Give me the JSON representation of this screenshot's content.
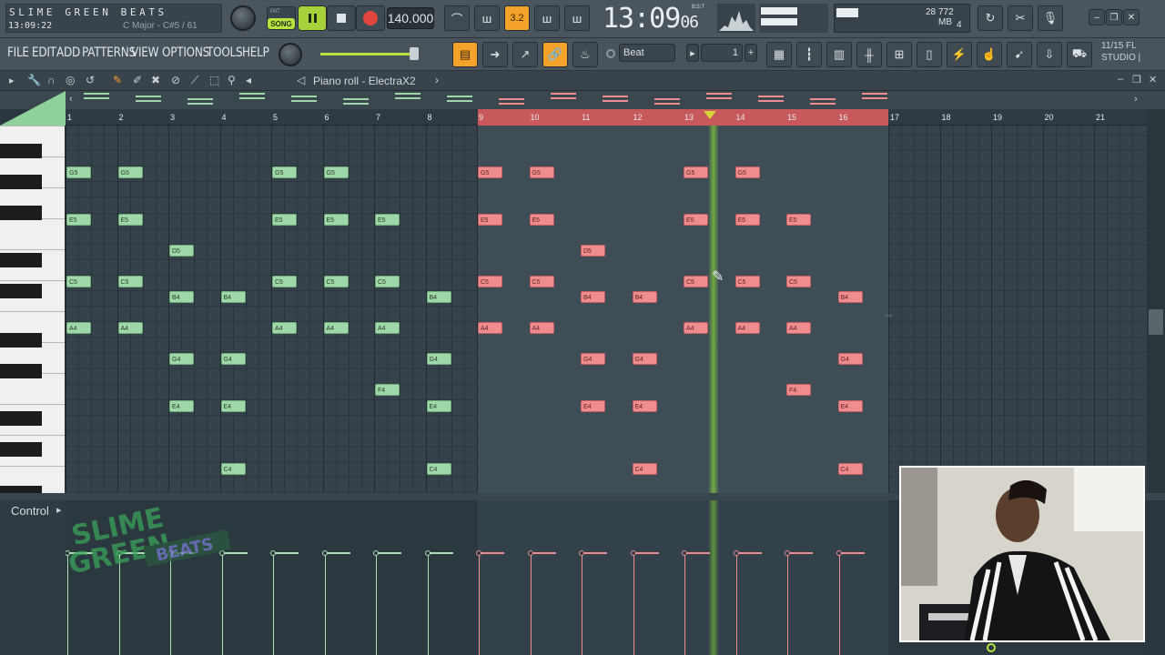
{
  "brand": {
    "title": "SLIME GREEN BEATS",
    "time": "13:09:22",
    "hint": "C Major - C#5 / 61"
  },
  "transport": {
    "mode_pat": "PAT",
    "mode_song": "SONG",
    "tempo": "140.000",
    "clock": "13:09",
    "clock_sub": "06",
    "bst": "B:S:T",
    "snap_value": "3.2"
  },
  "cpu": {
    "value1": "28",
    "mem": "772 MB",
    "value2": "4"
  },
  "menu": {
    "items": [
      "FILE",
      "EDIT",
      "ADD",
      "PATTERNS",
      "VIEW",
      "OPTIONS",
      "TOOLS",
      "HELP"
    ]
  },
  "toolbar": {
    "snap": "Beat",
    "pattern_num": "1",
    "version_line1": "11/15  FL",
    "version_line2": "STUDIO |"
  },
  "pianoroll": {
    "title": "Piano roll - ElectraX2"
  },
  "ruler": {
    "bars": [
      "1",
      "2",
      "3",
      "4",
      "5",
      "6",
      "7",
      "8",
      "9",
      "10",
      "11",
      "12",
      "13",
      "14",
      "15",
      "16",
      "17",
      "18",
      "19",
      "20",
      "21"
    ]
  },
  "control": {
    "label": "Control"
  },
  "watermark": {
    "line1": "SLIME",
    "line2": "GREEN",
    "line3": "BEATS"
  },
  "colors": {
    "song_green": "#b7e33e",
    "note_green": "#9fd8a8",
    "note_red": "#ef8c8e",
    "selection_ruler": "#c7585b",
    "accent_orange": "#f4a22a"
  },
  "notes": [
    {
      "label": "G5",
      "bar": 1,
      "color": "g"
    },
    {
      "label": "G5",
      "bar": 2,
      "color": "g"
    },
    {
      "label": "G5",
      "bar": 5,
      "color": "g"
    },
    {
      "label": "G5",
      "bar": 6,
      "color": "g"
    },
    {
      "label": "G5",
      "bar": 9,
      "color": "r"
    },
    {
      "label": "G5",
      "bar": 10,
      "color": "r"
    },
    {
      "label": "G5",
      "bar": 13,
      "color": "r"
    },
    {
      "label": "G5",
      "bar": 14,
      "color": "r"
    },
    {
      "label": "E5",
      "bar": 1,
      "color": "g"
    },
    {
      "label": "E5",
      "bar": 2,
      "color": "g"
    },
    {
      "label": "E5",
      "bar": 5,
      "color": "g"
    },
    {
      "label": "E5",
      "bar": 6,
      "color": "g"
    },
    {
      "label": "E5",
      "bar": 7,
      "color": "g"
    },
    {
      "label": "E5",
      "bar": 9,
      "color": "r"
    },
    {
      "label": "E5",
      "bar": 10,
      "color": "r"
    },
    {
      "label": "E5",
      "bar": 13,
      "color": "r"
    },
    {
      "label": "E5",
      "bar": 14,
      "color": "r"
    },
    {
      "label": "E5",
      "bar": 15,
      "color": "r"
    },
    {
      "label": "D5",
      "bar": 3,
      "color": "g"
    },
    {
      "label": "D5",
      "bar": 11,
      "color": "r"
    },
    {
      "label": "C5",
      "bar": 1,
      "color": "g"
    },
    {
      "label": "C5",
      "bar": 2,
      "color": "g"
    },
    {
      "label": "C5",
      "bar": 5,
      "color": "g"
    },
    {
      "label": "C5",
      "bar": 6,
      "color": "g"
    },
    {
      "label": "C5",
      "bar": 7,
      "color": "g"
    },
    {
      "label": "C5",
      "bar": 9,
      "color": "r"
    },
    {
      "label": "C5",
      "bar": 10,
      "color": "r"
    },
    {
      "label": "C5",
      "bar": 13,
      "color": "r"
    },
    {
      "label": "C5",
      "bar": 14,
      "color": "r"
    },
    {
      "label": "C5",
      "bar": 15,
      "color": "r"
    },
    {
      "label": "B4",
      "bar": 3,
      "color": "g"
    },
    {
      "label": "B4",
      "bar": 4,
      "color": "g"
    },
    {
      "label": "B4",
      "bar": 8,
      "color": "g"
    },
    {
      "label": "B4",
      "bar": 11,
      "color": "r"
    },
    {
      "label": "B4",
      "bar": 12,
      "color": "r"
    },
    {
      "label": "B4",
      "bar": 16,
      "color": "r"
    },
    {
      "label": "A4",
      "bar": 1,
      "color": "g"
    },
    {
      "label": "A4",
      "bar": 2,
      "color": "g"
    },
    {
      "label": "A4",
      "bar": 5,
      "color": "g"
    },
    {
      "label": "A4",
      "bar": 6,
      "color": "g"
    },
    {
      "label": "A4",
      "bar": 7,
      "color": "g"
    },
    {
      "label": "A4",
      "bar": 9,
      "color": "r"
    },
    {
      "label": "A4",
      "bar": 10,
      "color": "r"
    },
    {
      "label": "A4",
      "bar": 13,
      "color": "r"
    },
    {
      "label": "A4",
      "bar": 14,
      "color": "r"
    },
    {
      "label": "A4",
      "bar": 15,
      "color": "r"
    },
    {
      "label": "G4",
      "bar": 3,
      "color": "g"
    },
    {
      "label": "G4",
      "bar": 4,
      "color": "g"
    },
    {
      "label": "G4",
      "bar": 8,
      "color": "g"
    },
    {
      "label": "G4",
      "bar": 11,
      "color": "r"
    },
    {
      "label": "G4",
      "bar": 12,
      "color": "r"
    },
    {
      "label": "G4",
      "bar": 16,
      "color": "r"
    },
    {
      "label": "F4",
      "bar": 7,
      "color": "g"
    },
    {
      "label": "F4",
      "bar": 15,
      "color": "r"
    },
    {
      "label": "E4",
      "bar": 3,
      "color": "g"
    },
    {
      "label": "E4",
      "bar": 4,
      "color": "g"
    },
    {
      "label": "E4",
      "bar": 8,
      "color": "g"
    },
    {
      "label": "E4",
      "bar": 11,
      "color": "r"
    },
    {
      "label": "E4",
      "bar": 12,
      "color": "r"
    },
    {
      "label": "E4",
      "bar": 16,
      "color": "r"
    },
    {
      "label": "C4",
      "bar": 4,
      "color": "g"
    },
    {
      "label": "C4",
      "bar": 8,
      "color": "g"
    },
    {
      "label": "C4",
      "bar": 12,
      "color": "r"
    },
    {
      "label": "C4",
      "bar": 16,
      "color": "r"
    }
  ],
  "velocities": [
    {
      "bar": 1,
      "color": "g"
    },
    {
      "bar": 2,
      "color": "g"
    },
    {
      "bar": 3,
      "color": "g"
    },
    {
      "bar": 4,
      "color": "g"
    },
    {
      "bar": 5,
      "color": "g"
    },
    {
      "bar": 6,
      "color": "g"
    },
    {
      "bar": 7,
      "color": "g"
    },
    {
      "bar": 8,
      "color": "g"
    },
    {
      "bar": 9,
      "color": "r"
    },
    {
      "bar": 10,
      "color": "r"
    },
    {
      "bar": 11,
      "color": "r"
    },
    {
      "bar": 12,
      "color": "r"
    },
    {
      "bar": 13,
      "color": "r"
    },
    {
      "bar": 14,
      "color": "r"
    },
    {
      "bar": 15,
      "color": "r"
    },
    {
      "bar": 16,
      "color": "r"
    }
  ]
}
